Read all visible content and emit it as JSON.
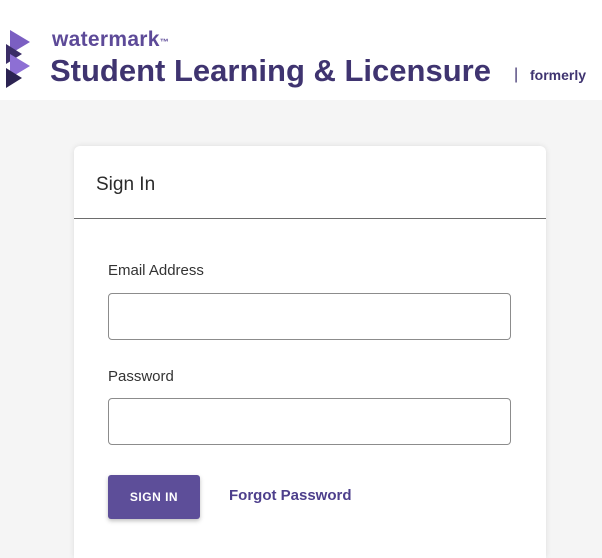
{
  "brand": {
    "name_small": "watermark",
    "trademark": "™",
    "product": "Student Learning & Licensure",
    "separator": "|",
    "formerly": "formerly",
    "logo_icon": "watermark-logo-icon",
    "colors": {
      "primary": "#5d4e99",
      "dark": "#3f3470"
    }
  },
  "signin_card": {
    "title": "Sign In",
    "email": {
      "label": "Email Address",
      "value": "",
      "placeholder": ""
    },
    "password": {
      "label": "Password",
      "value": "",
      "placeholder": ""
    },
    "submit_label": "SIGN IN",
    "forgot_label": "Forgot Password"
  }
}
